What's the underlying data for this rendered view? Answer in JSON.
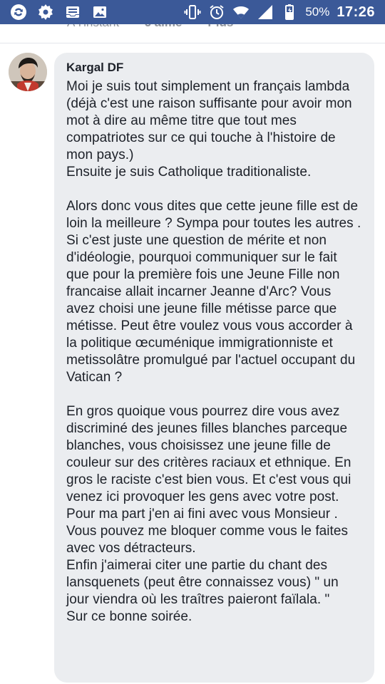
{
  "status_bar": {
    "battery_percent": "50%",
    "time": "17:26",
    "icons_left": [
      "sync-icon",
      "gear-icon",
      "inbox-icon",
      "image-icon"
    ],
    "icons_right": [
      "vibrate-icon",
      "alarm-icon",
      "wifi-icon",
      "signal-icon",
      "battery-icon"
    ]
  },
  "previous_comment": {
    "timestamp": "À l'instant",
    "like_label": "J'aime",
    "more_label": "Plus"
  },
  "comment": {
    "author": "Kargal DF",
    "text": "Moi je suis tout simplement un français lambda (déjà c'est une raison suffisante pour avoir mon mot à dire au même titre que tout mes compatriotes sur ce qui touche à l'histoire de mon pays.)\nEnsuite je suis Catholique traditionaliste.\n\nAlors donc vous dites que cette jeune fille est de loin la meilleure ? Sympa pour toutes les autres .\nSi c'est juste une question de mérite et non d'idéologie, pourquoi communiquer sur le fait que pour la première fois une Jeune Fille non francaise allait incarner Jeanne d'Arc? Vous avez choisi une jeune fille métisse parce que métisse. Peut être voulez vous vous accorder à la politique œcuménique immigrationniste et metissolâtre promulgué par l'actuel occupant du Vatican ?\n\nEn gros quoique vous pourrez dire vous avez discriminé des jeunes filles blanches parceque blanches, vous choisissez une jeune fille de couleur sur des critères raciaux et ethnique. En gros le raciste c'est bien vous. Et c'est vous qui venez ici provoquer les gens avec votre post.\nPour ma part j'en ai fini avec vous Monsieur . Vous pouvez me bloquer comme vous le faites avec vos détracteurs.\nEnfin j'aimerai citer une partie du chant des lansquenets (peut être connaissez vous) \" un jour viendra où les traîtres paieront faïlala. \"\nSur ce bonne soirée."
  },
  "colors": {
    "status_bar_bg": "#3b5998",
    "bubble_bg": "#ebedf0",
    "text": "#1d2129",
    "muted": "#90949c"
  }
}
